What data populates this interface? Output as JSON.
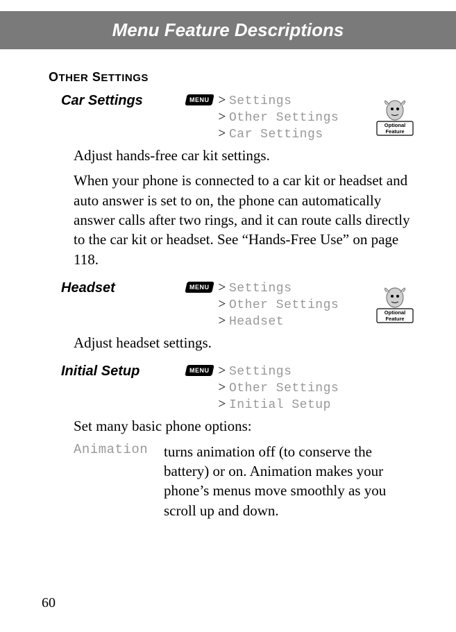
{
  "header": {
    "title": "Menu Feature Descriptions"
  },
  "sectionHeading": {
    "firstLetter1": "O",
    "rest1": "THER",
    "firstLetter2": "S",
    "rest2": "ETTINGS"
  },
  "menuKeyLabel": "MENU",
  "features": [
    {
      "title": "Car Settings",
      "path": [
        "Settings",
        "Other Settings",
        "Car Settings"
      ],
      "hasBadge": true,
      "body": [
        "Adjust hands-free car kit settings.",
        "When your phone is connected to a car kit or headset and auto answer is set to on, the phone can automatically answer calls after two rings, and it can route calls directly to the car kit or headset. See “Hands-Free Use” on page 118."
      ]
    },
    {
      "title": "Headset",
      "path": [
        "Settings",
        "Other Settings",
        "Headset"
      ],
      "hasBadge": true,
      "body": [
        "Adjust headset settings."
      ]
    },
    {
      "title": "Initial Setup",
      "path": [
        "Settings",
        "Other Settings",
        "Initial Setup"
      ],
      "hasBadge": false,
      "body": [
        "Set many basic phone options:"
      ],
      "options": [
        {
          "name": "Animation",
          "desc": "turns animation off (to conserve the battery) or on. Animation makes your phone’s menus move smoothly as you scroll up and down."
        }
      ]
    }
  ],
  "optionalBadge": {
    "line1": "Optional",
    "line2": "Feature"
  },
  "pageNumber": "60"
}
